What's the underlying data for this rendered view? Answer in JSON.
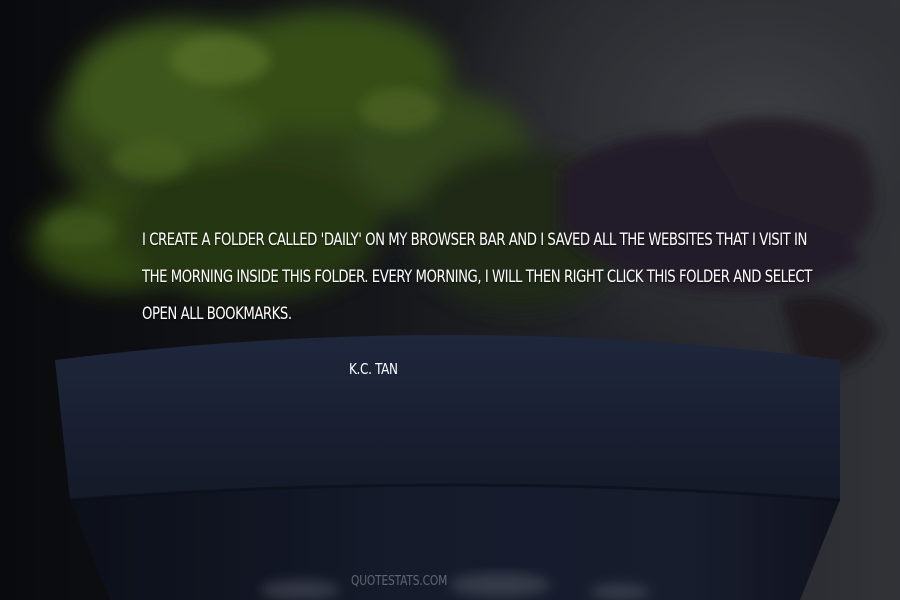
{
  "quote": {
    "lines": [
      "I create a folder called 'Daily' on my browser bar and I saved all the websites that I visit in",
      "the morning inside this folder. Every morning, I will then right click this folder and select",
      "Open All Bookmarks."
    ]
  },
  "author": "K.C. Tan",
  "watermark": "QUOTESTATS.COM",
  "colors": {
    "text": "#ffffff",
    "pot": "#1b2236",
    "foliage": "#3e5a1c",
    "background": "#1a1c20"
  }
}
